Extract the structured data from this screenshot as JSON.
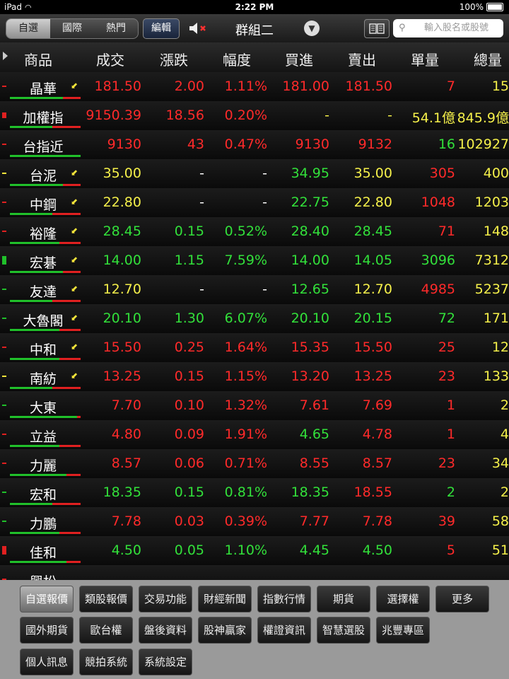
{
  "status": {
    "device": "iPad",
    "time": "2:22 PM",
    "battery": "100%"
  },
  "toolbar": {
    "segments": [
      "自選",
      "國際",
      "熱門"
    ],
    "edit": "編輯",
    "group": "群組二",
    "search_placeholder": "輸入股名或股號"
  },
  "columns": [
    "商品",
    "成交",
    "漲跌",
    "幅度",
    "買進",
    "賣出",
    "單量",
    "總量"
  ],
  "rows": [
    {
      "name": "晶華",
      "price": "181.50",
      "change": "2.00",
      "pct": "1.11%",
      "bid": "181.00",
      "ask": "181.50",
      "vol": "7",
      "total": "15",
      "c": [
        "red",
        "red",
        "red",
        "red",
        "red",
        "red",
        "yellow"
      ],
      "sw": true
    },
    {
      "name": "加權指",
      "price": "9150.39",
      "change": "18.56",
      "pct": "0.20%",
      "bid": "-",
      "ask": "-",
      "vol": "54.1億",
      "total": "845.9億",
      "c": [
        "red",
        "red",
        "red",
        "yellow",
        "yellow",
        "yellow",
        "yellow"
      ],
      "sw": false
    },
    {
      "name": "台指近",
      "price": "9130",
      "change": "43",
      "pct": "0.47%",
      "bid": "9130",
      "ask": "9132",
      "vol": "16",
      "total": "102927",
      "c": [
        "red",
        "red",
        "red",
        "red",
        "red",
        "green",
        "yellow"
      ],
      "sw": false
    },
    {
      "name": "台泥",
      "price": "35.00",
      "change": "-",
      "pct": "-",
      "bid": "34.95",
      "ask": "35.00",
      "vol": "305",
      "total": "400",
      "c": [
        "yellow",
        "white",
        "white",
        "green",
        "yellow",
        "red",
        "yellow"
      ],
      "sw": true
    },
    {
      "name": "中鋼",
      "price": "22.80",
      "change": "-",
      "pct": "-",
      "bid": "22.75",
      "ask": "22.80",
      "vol": "1048",
      "total": "1203",
      "c": [
        "yellow",
        "white",
        "white",
        "green",
        "yellow",
        "red",
        "yellow"
      ],
      "sw": true
    },
    {
      "name": "裕隆",
      "price": "28.45",
      "change": "0.15",
      "pct": "0.52%",
      "bid": "28.40",
      "ask": "28.45",
      "vol": "71",
      "total": "148",
      "c": [
        "green",
        "green",
        "green",
        "green",
        "green",
        "red",
        "yellow"
      ],
      "sw": true
    },
    {
      "name": "宏碁",
      "price": "14.00",
      "change": "1.15",
      "pct": "7.59%",
      "bid": "14.00",
      "ask": "14.05",
      "vol": "3096",
      "total": "7312",
      "c": [
        "green",
        "green",
        "green",
        "green",
        "green",
        "green",
        "yellow"
      ],
      "sw": true
    },
    {
      "name": "友達",
      "price": "12.70",
      "change": "-",
      "pct": "-",
      "bid": "12.65",
      "ask": "12.70",
      "vol": "4985",
      "total": "5237",
      "c": [
        "yellow",
        "white",
        "white",
        "green",
        "yellow",
        "red",
        "yellow"
      ],
      "sw": true
    },
    {
      "name": "大魯閣",
      "price": "20.10",
      "change": "1.30",
      "pct": "6.07%",
      "bid": "20.10",
      "ask": "20.15",
      "vol": "72",
      "total": "171",
      "c": [
        "green",
        "green",
        "green",
        "green",
        "green",
        "green",
        "yellow"
      ],
      "sw": true
    },
    {
      "name": "中和",
      "price": "15.50",
      "change": "0.25",
      "pct": "1.64%",
      "bid": "15.35",
      "ask": "15.50",
      "vol": "25",
      "total": "12",
      "c": [
        "red",
        "red",
        "red",
        "red",
        "red",
        "red",
        "yellow"
      ],
      "sw": true
    },
    {
      "name": "南紡",
      "price": "13.25",
      "change": "0.15",
      "pct": "1.15%",
      "bid": "13.20",
      "ask": "13.25",
      "vol": "23",
      "total": "133",
      "c": [
        "red",
        "red",
        "red",
        "red",
        "red",
        "red",
        "yellow"
      ],
      "sw": true
    },
    {
      "name": "大東",
      "price": "7.70",
      "change": "0.10",
      "pct": "1.32%",
      "bid": "7.61",
      "ask": "7.69",
      "vol": "1",
      "total": "2",
      "c": [
        "red",
        "red",
        "red",
        "red",
        "red",
        "red",
        "yellow"
      ],
      "sw": false
    },
    {
      "name": "立益",
      "price": "4.80",
      "change": "0.09",
      "pct": "1.91%",
      "bid": "4.65",
      "ask": "4.78",
      "vol": "1",
      "total": "4",
      "c": [
        "red",
        "red",
        "red",
        "green",
        "red",
        "red",
        "yellow"
      ],
      "sw": false
    },
    {
      "name": "力麗",
      "price": "8.57",
      "change": "0.06",
      "pct": "0.71%",
      "bid": "8.55",
      "ask": "8.57",
      "vol": "23",
      "total": "34",
      "c": [
        "red",
        "red",
        "red",
        "red",
        "red",
        "red",
        "yellow"
      ],
      "sw": false
    },
    {
      "name": "宏和",
      "price": "18.35",
      "change": "0.15",
      "pct": "0.81%",
      "bid": "18.35",
      "ask": "18.55",
      "vol": "2",
      "total": "2",
      "c": [
        "green",
        "green",
        "green",
        "green",
        "red",
        "green",
        "yellow"
      ],
      "sw": false
    },
    {
      "name": "力鵬",
      "price": "7.78",
      "change": "0.03",
      "pct": "0.39%",
      "bid": "7.77",
      "ask": "7.78",
      "vol": "39",
      "total": "58",
      "c": [
        "red",
        "red",
        "red",
        "red",
        "red",
        "red",
        "yellow"
      ],
      "sw": false
    },
    {
      "name": "佳和",
      "price": "4.50",
      "change": "0.05",
      "pct": "1.10%",
      "bid": "4.45",
      "ask": "4.50",
      "vol": "5",
      "total": "51",
      "c": [
        "green",
        "green",
        "green",
        "green",
        "green",
        "red",
        "yellow"
      ],
      "sw": false
    },
    {
      "name": "興松",
      "price": "",
      "change": "",
      "pct": "",
      "bid": "",
      "ask": "",
      "vol": "",
      "total": "",
      "c": [
        "red",
        "red",
        "red",
        "red",
        "red",
        "red",
        "yellow"
      ],
      "sw": false
    }
  ],
  "bottom_menu": [
    [
      "自選報價",
      "類股報價",
      "交易功能",
      "財經新聞",
      "指數行情",
      "期貨",
      "選擇權",
      "更多"
    ],
    [
      "國外期貨",
      "歐台權",
      "盤後資料",
      "股神贏家",
      "權證資訊",
      "智慧選股",
      "兆豐專區"
    ],
    [
      "個人訊息",
      "競拍系統",
      "系統設定"
    ]
  ],
  "colors": {
    "up": "#ff2a2a",
    "down": "#32e03a",
    "flat": "#f5f04a"
  }
}
